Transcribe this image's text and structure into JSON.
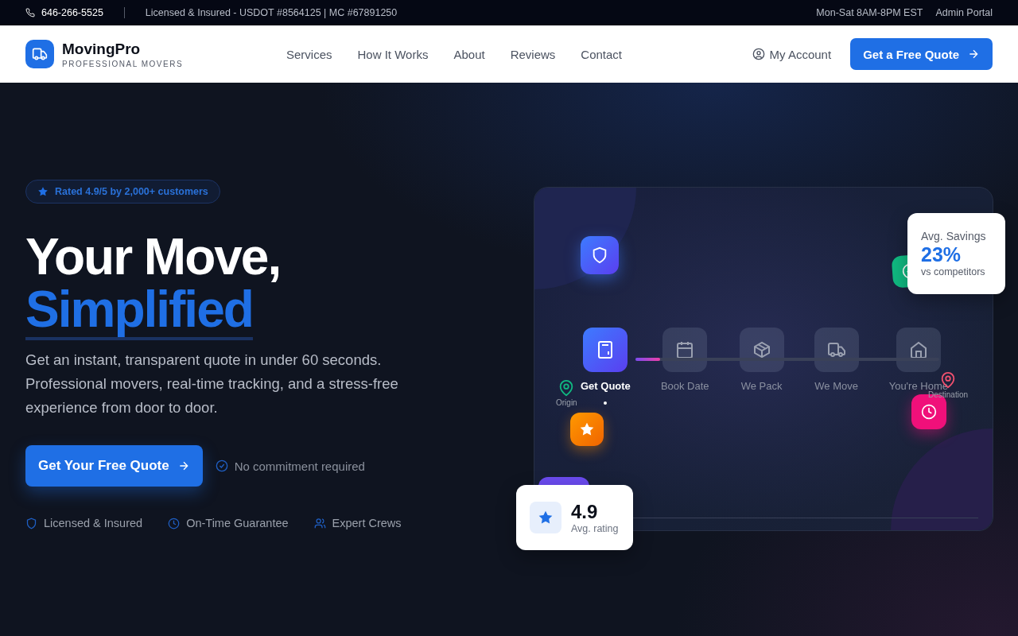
{
  "top_bar": {
    "phone": "646-266-5525",
    "license": "Licensed & Insured - USDOT #8564125 | MC #67891250",
    "hours": "Mon-Sat 8AM-8PM EST",
    "admin_link": "Admin Portal"
  },
  "header": {
    "brand": "MovingPro",
    "tagline": "PROFESSIONAL MOVERS",
    "nav": [
      "Services",
      "How It Works",
      "About",
      "Reviews",
      "Contact"
    ],
    "account": "My Account",
    "cta": "Get a Free Quote"
  },
  "hero": {
    "badge": "Rated 4.9/5 by 2,000+ customers",
    "heading": "Your Move,",
    "heading_highlight": "Simplified",
    "description": "Get an instant, transparent quote in under 60 seconds. Professional movers, real-time tracking, and a stress-free experience from door to door.",
    "cta": "Get Your Free Quote",
    "note": "No commitment required",
    "features": [
      {
        "kind": "shield",
        "label": "Licensed & Insured"
      },
      {
        "kind": "clock",
        "label": "On-Time Guarantee"
      },
      {
        "kind": "people",
        "label": "Expert Crews"
      }
    ]
  },
  "illustration": {
    "progress": {
      "level": 0.08
    },
    "steps": [
      {
        "kind": "calculator",
        "label": "Get Quote",
        "selected": true
      },
      {
        "kind": "calendar",
        "label": "Book Date",
        "selected": false
      },
      {
        "kind": "box",
        "label": "We Pack",
        "selected": false
      },
      {
        "kind": "truck",
        "label": "We Move",
        "selected": false
      },
      {
        "kind": "home",
        "label": "You're Home",
        "selected": false
      }
    ],
    "origin": "Origin",
    "destination": "Destination",
    "savings": {
      "label": "Avg. Savings",
      "value": "23%",
      "note": "vs competitors"
    },
    "rating": {
      "value": "4.9",
      "label": "Avg. rating"
    }
  }
}
